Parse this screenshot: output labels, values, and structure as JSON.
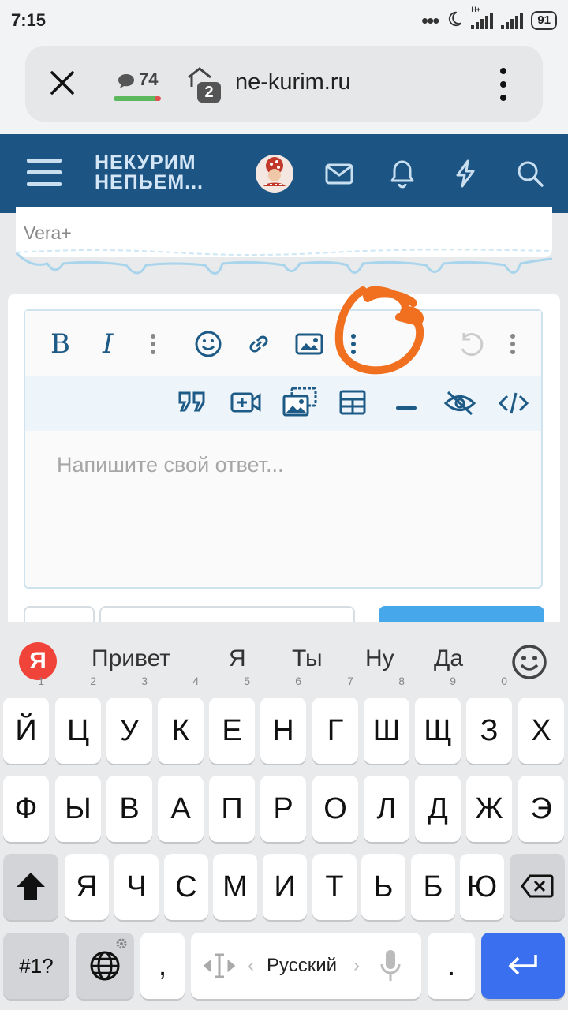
{
  "status_bar": {
    "time": "7:15",
    "battery": "91",
    "network": "H+"
  },
  "browser": {
    "tab_count": "74",
    "shield_count": "2",
    "url": "ne-kurim.ru"
  },
  "site_header": {
    "logo_line1": "НЕКУРИМ",
    "logo_line2": "НЕПЬЕМ..."
  },
  "post": {
    "signature": "Vera+"
  },
  "editor": {
    "placeholder": "Напишите свой ответ..."
  },
  "keyboard": {
    "suggestions": [
      "Привет",
      "Я",
      "Ты",
      "Ну",
      "Да"
    ],
    "row1": [
      {
        "k": "Й",
        "n": "1"
      },
      {
        "k": "Ц",
        "n": "2"
      },
      {
        "k": "У",
        "n": "3"
      },
      {
        "k": "К",
        "n": "4"
      },
      {
        "k": "Е",
        "n": "5"
      },
      {
        "k": "Н",
        "n": "6"
      },
      {
        "k": "Г",
        "n": "7"
      },
      {
        "k": "Ш",
        "n": "8"
      },
      {
        "k": "Щ",
        "n": "9"
      },
      {
        "k": "З",
        "n": "0"
      },
      {
        "k": "Х",
        "n": ""
      }
    ],
    "row2": [
      "Ф",
      "Ы",
      "В",
      "А",
      "П",
      "Р",
      "О",
      "Л",
      "Д",
      "Ж",
      "Э"
    ],
    "row3": [
      "Я",
      "Ч",
      "С",
      "М",
      "И",
      "Т",
      "Ь",
      "Б",
      "Ю"
    ],
    "symbols_key": "#1?",
    "comma_key": ",",
    "space_label": "Русский",
    "period_key": "."
  },
  "colors": {
    "header": "#1c5484",
    "accent": "#3a6ff0",
    "annotation": "#f07020"
  }
}
